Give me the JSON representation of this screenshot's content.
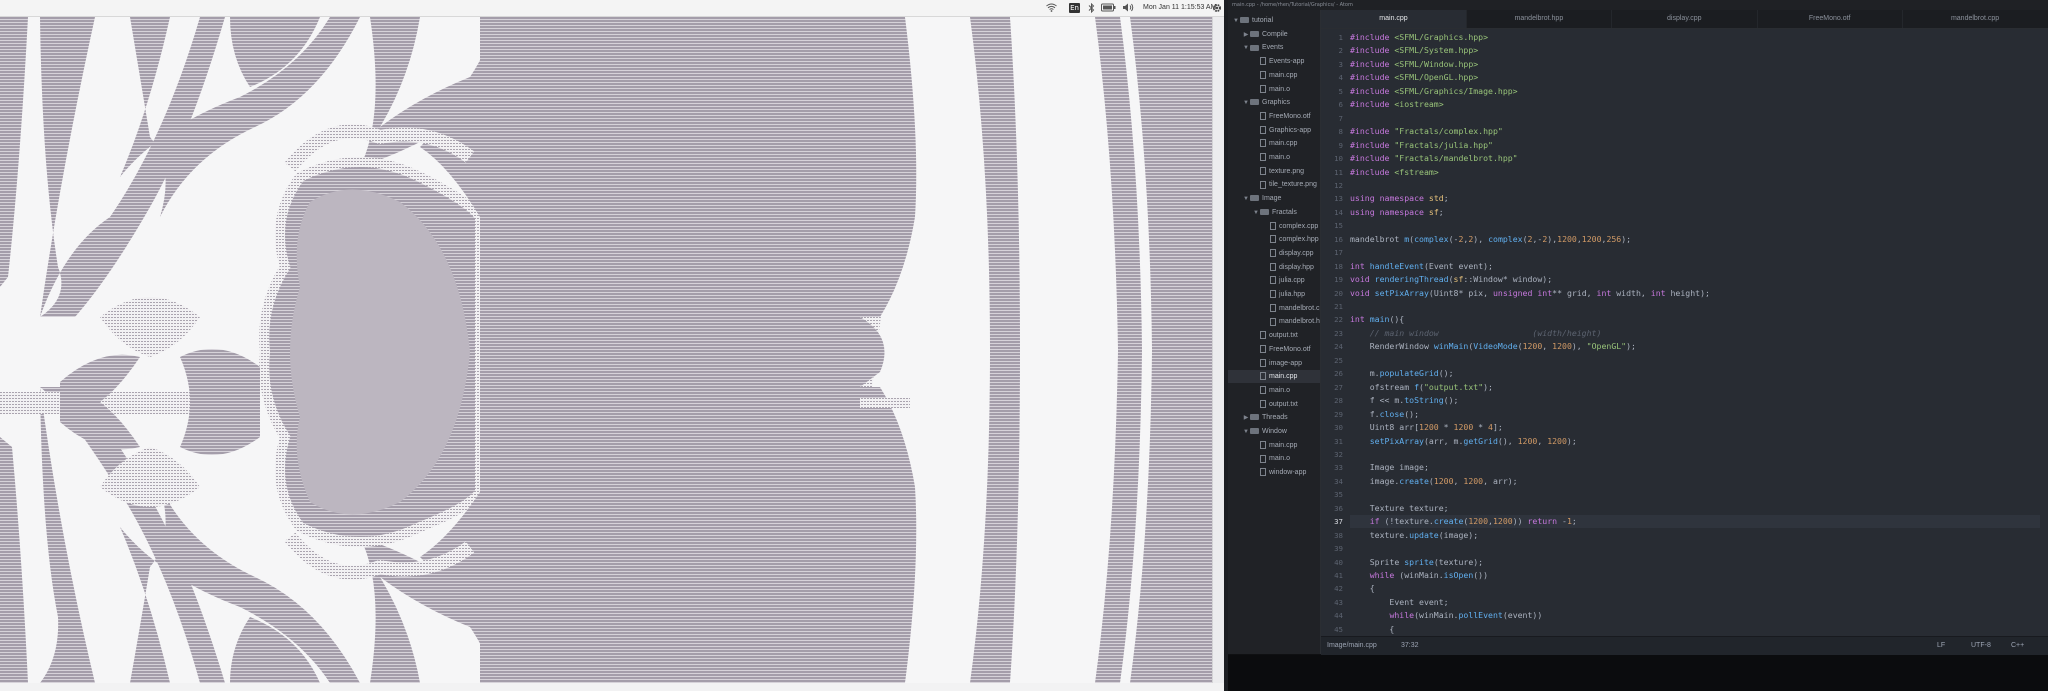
{
  "left_screen": {
    "topbar": {
      "keyboard_layout": "En",
      "datetime": "Mon Jan 11 1:15:53 AM"
    },
    "render_window": {
      "content": "mandelbrot-fractal-render",
      "colors": {
        "light": "#f6f6f7",
        "dark": "#9d96a0"
      }
    }
  },
  "right_screen": {
    "titlebar": "main.cpp - /home/rhen/Tutorial/Graphics/ - Atom",
    "tree": {
      "items": [
        {
          "label": "tutorial",
          "type": "folder",
          "depth": 0,
          "open": true
        },
        {
          "label": "Compile",
          "type": "folder",
          "depth": 1,
          "open": false
        },
        {
          "label": "Events",
          "type": "folder",
          "depth": 1,
          "open": true
        },
        {
          "label": "Events-app",
          "type": "file",
          "depth": 2
        },
        {
          "label": "main.cpp",
          "type": "file",
          "depth": 2
        },
        {
          "label": "main.o",
          "type": "file",
          "depth": 2
        },
        {
          "label": "Graphics",
          "type": "folder",
          "depth": 1,
          "open": true
        },
        {
          "label": "FreeMono.otf",
          "type": "file",
          "depth": 2
        },
        {
          "label": "Graphics-app",
          "type": "file",
          "depth": 2
        },
        {
          "label": "main.cpp",
          "type": "file",
          "depth": 2
        },
        {
          "label": "main.o",
          "type": "file",
          "depth": 2
        },
        {
          "label": "texture.png",
          "type": "file",
          "depth": 2
        },
        {
          "label": "tile_texture.png",
          "type": "file",
          "depth": 2
        },
        {
          "label": "Image",
          "type": "folder",
          "depth": 1,
          "open": true
        },
        {
          "label": "Fractals",
          "type": "folder",
          "depth": 2,
          "open": true
        },
        {
          "label": "complex.cpp",
          "type": "file",
          "depth": 3
        },
        {
          "label": "complex.hpp",
          "type": "file",
          "depth": 3
        },
        {
          "label": "display.cpp",
          "type": "file",
          "depth": 3
        },
        {
          "label": "display.hpp",
          "type": "file",
          "depth": 3
        },
        {
          "label": "julia.cpp",
          "type": "file",
          "depth": 3
        },
        {
          "label": "julia.hpp",
          "type": "file",
          "depth": 3
        },
        {
          "label": "mandelbrot.cpp",
          "type": "file",
          "depth": 3
        },
        {
          "label": "mandelbrot.hpp",
          "type": "file",
          "depth": 3
        },
        {
          "label": "output.txt",
          "type": "file",
          "depth": 2
        },
        {
          "label": "FreeMono.otf",
          "type": "file",
          "depth": 2
        },
        {
          "label": "image-app",
          "type": "file",
          "depth": 2
        },
        {
          "label": "main.cpp",
          "type": "file",
          "depth": 2,
          "selected": true
        },
        {
          "label": "main.o",
          "type": "file",
          "depth": 2
        },
        {
          "label": "output.txt",
          "type": "file",
          "depth": 2
        },
        {
          "label": "Threads",
          "type": "folder",
          "depth": 1,
          "open": false
        },
        {
          "label": "Window",
          "type": "folder",
          "depth": 1,
          "open": true
        },
        {
          "label": "main.cpp",
          "type": "file",
          "depth": 2
        },
        {
          "label": "main.o",
          "type": "file",
          "depth": 2
        },
        {
          "label": "window-app",
          "type": "file",
          "depth": 2
        }
      ]
    },
    "tabs": [
      "main.cpp",
      "mandelbrot.hpp",
      "display.cpp",
      "FreeMono.otf",
      "mandelbrot.cpp"
    ],
    "active_tab": 0,
    "editor": {
      "first_line": 1,
      "current_line": 37,
      "colors": {
        "keyword": "#c678dd",
        "string": "#98c379",
        "number": "#d19a66",
        "function": "#61afef",
        "type": "#e5c07b",
        "comment": "#5c6370",
        "plain": "#abb2bf"
      },
      "lines": [
        "#include <SFML/Graphics.hpp>",
        "#include <SFML/System.hpp>",
        "#include <SFML/Window.hpp>",
        "#include <SFML/OpenGL.hpp>",
        "#include <SFML/Graphics/Image.hpp>",
        "#include <iostream>",
        "",
        "#include \"Fractals/complex.hpp\"",
        "#include \"Fractals/julia.hpp\"",
        "#include \"Fractals/mandelbrot.hpp\"",
        "#include <fstream>",
        "",
        "using namespace std;",
        "using namespace sf;",
        "",
        "mandelbrot m(complex(-2,2), complex(2,-2),1200,1200,256);",
        "",
        "int handleEvent(Event event);",
        "void renderingThread(sf::Window* window);",
        "void setPixArray(Uint8* pix, unsigned int** grid, int width, int height);",
        "",
        "int main(){",
        "    // main window                   (width/height)",
        "    RenderWindow winMain(VideoMode(1200, 1200), \"OpenGL\");",
        "",
        "    m.populateGrid();",
        "    ofstream f(\"output.txt\");",
        "    f << m.toString();",
        "    f.close();",
        "    Uint8 arr[1200 * 1200 * 4];",
        "    setPixArray(arr, m.getGrid(), 1200, 1200);",
        "",
        "    Image image;",
        "    image.create(1200, 1200, arr);",
        "",
        "    Texture texture;",
        "    if (!texture.create(1200,1200)) return -1;",
        "    texture.update(image);",
        "",
        "    Sprite sprite(texture);",
        "    while (winMain.isOpen())",
        "    {",
        "        Event event;",
        "        while(winMain.pollEvent(event))",
        "        {"
      ]
    },
    "statusbar": {
      "path": "Image/main.cpp",
      "cursor": "37:32",
      "line_ending": "LF",
      "encoding": "UTF-8",
      "grammar": "C++"
    }
  }
}
